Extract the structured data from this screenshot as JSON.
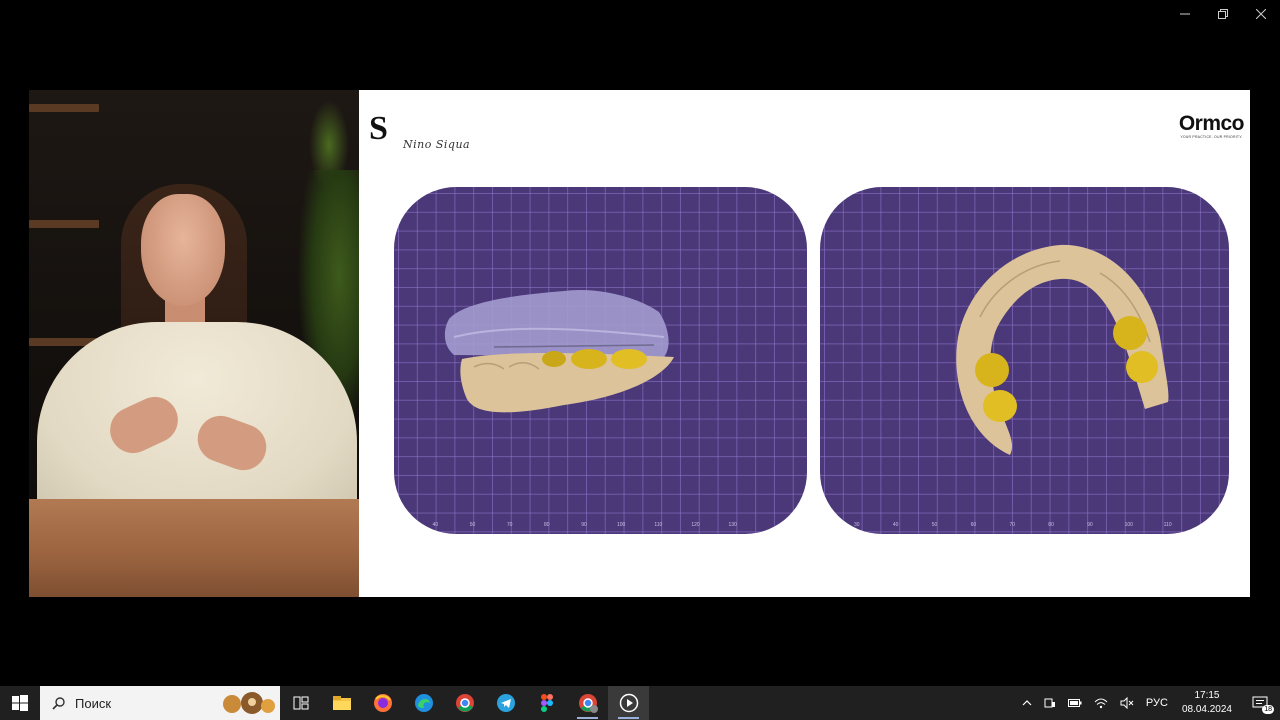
{
  "window": {
    "controls": [
      "minimize-icon",
      "restore-icon",
      "close-icon"
    ]
  },
  "slide": {
    "brand_monogram": "S",
    "brand_signature": "Nino Siqua",
    "partner_logo": "Ormco",
    "partner_tagline": "YOUR PRACTICE. OUR PRIORITY.",
    "scan_left_axis": [
      "40",
      "50",
      "70",
      "80",
      "90",
      "100",
      "110",
      "120",
      "130"
    ],
    "scan_right_axis": [
      "30",
      "40",
      "50",
      "60",
      "70",
      "80",
      "90",
      "100",
      "110"
    ],
    "colors": {
      "scan_background": "#4a3878",
      "tooth_model": "#dcc39a",
      "crowns": "#d8b41c",
      "aligner": "#a39ccf"
    }
  },
  "taskbar": {
    "search_placeholder": "Поиск",
    "apps": [
      "task-view-icon",
      "file-explorer-icon",
      "firefox-icon",
      "edge-icon",
      "chrome-icon",
      "telegram-icon",
      "figma-icon",
      "chrome-profile-icon",
      "media-player-icon"
    ],
    "tray": {
      "language": "РУС",
      "time": "17:15",
      "date": "08.04.2024",
      "notifications": "18"
    }
  }
}
